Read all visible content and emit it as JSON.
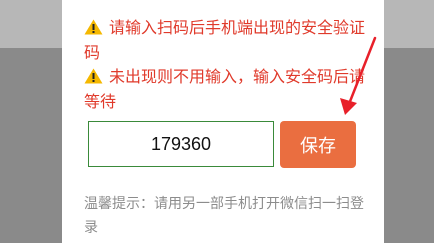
{
  "warnings": [
    "请输入扫码后手机端出现的安全验证码",
    "未出现则不用输入，输入安全码后请等待"
  ],
  "code_input": {
    "value": "179360"
  },
  "save_button": {
    "label": "保存"
  },
  "tip": "温馨提示：请用另一部手机打开微信扫一扫登录",
  "colors": {
    "warning_text": "#e03a2b",
    "warning_icon": "#f5b800",
    "save_button": "#ea6e40",
    "input_border": "#3a8a3a",
    "annotation_arrow": "#e8202a"
  },
  "icons": [
    "warning-icon"
  ]
}
